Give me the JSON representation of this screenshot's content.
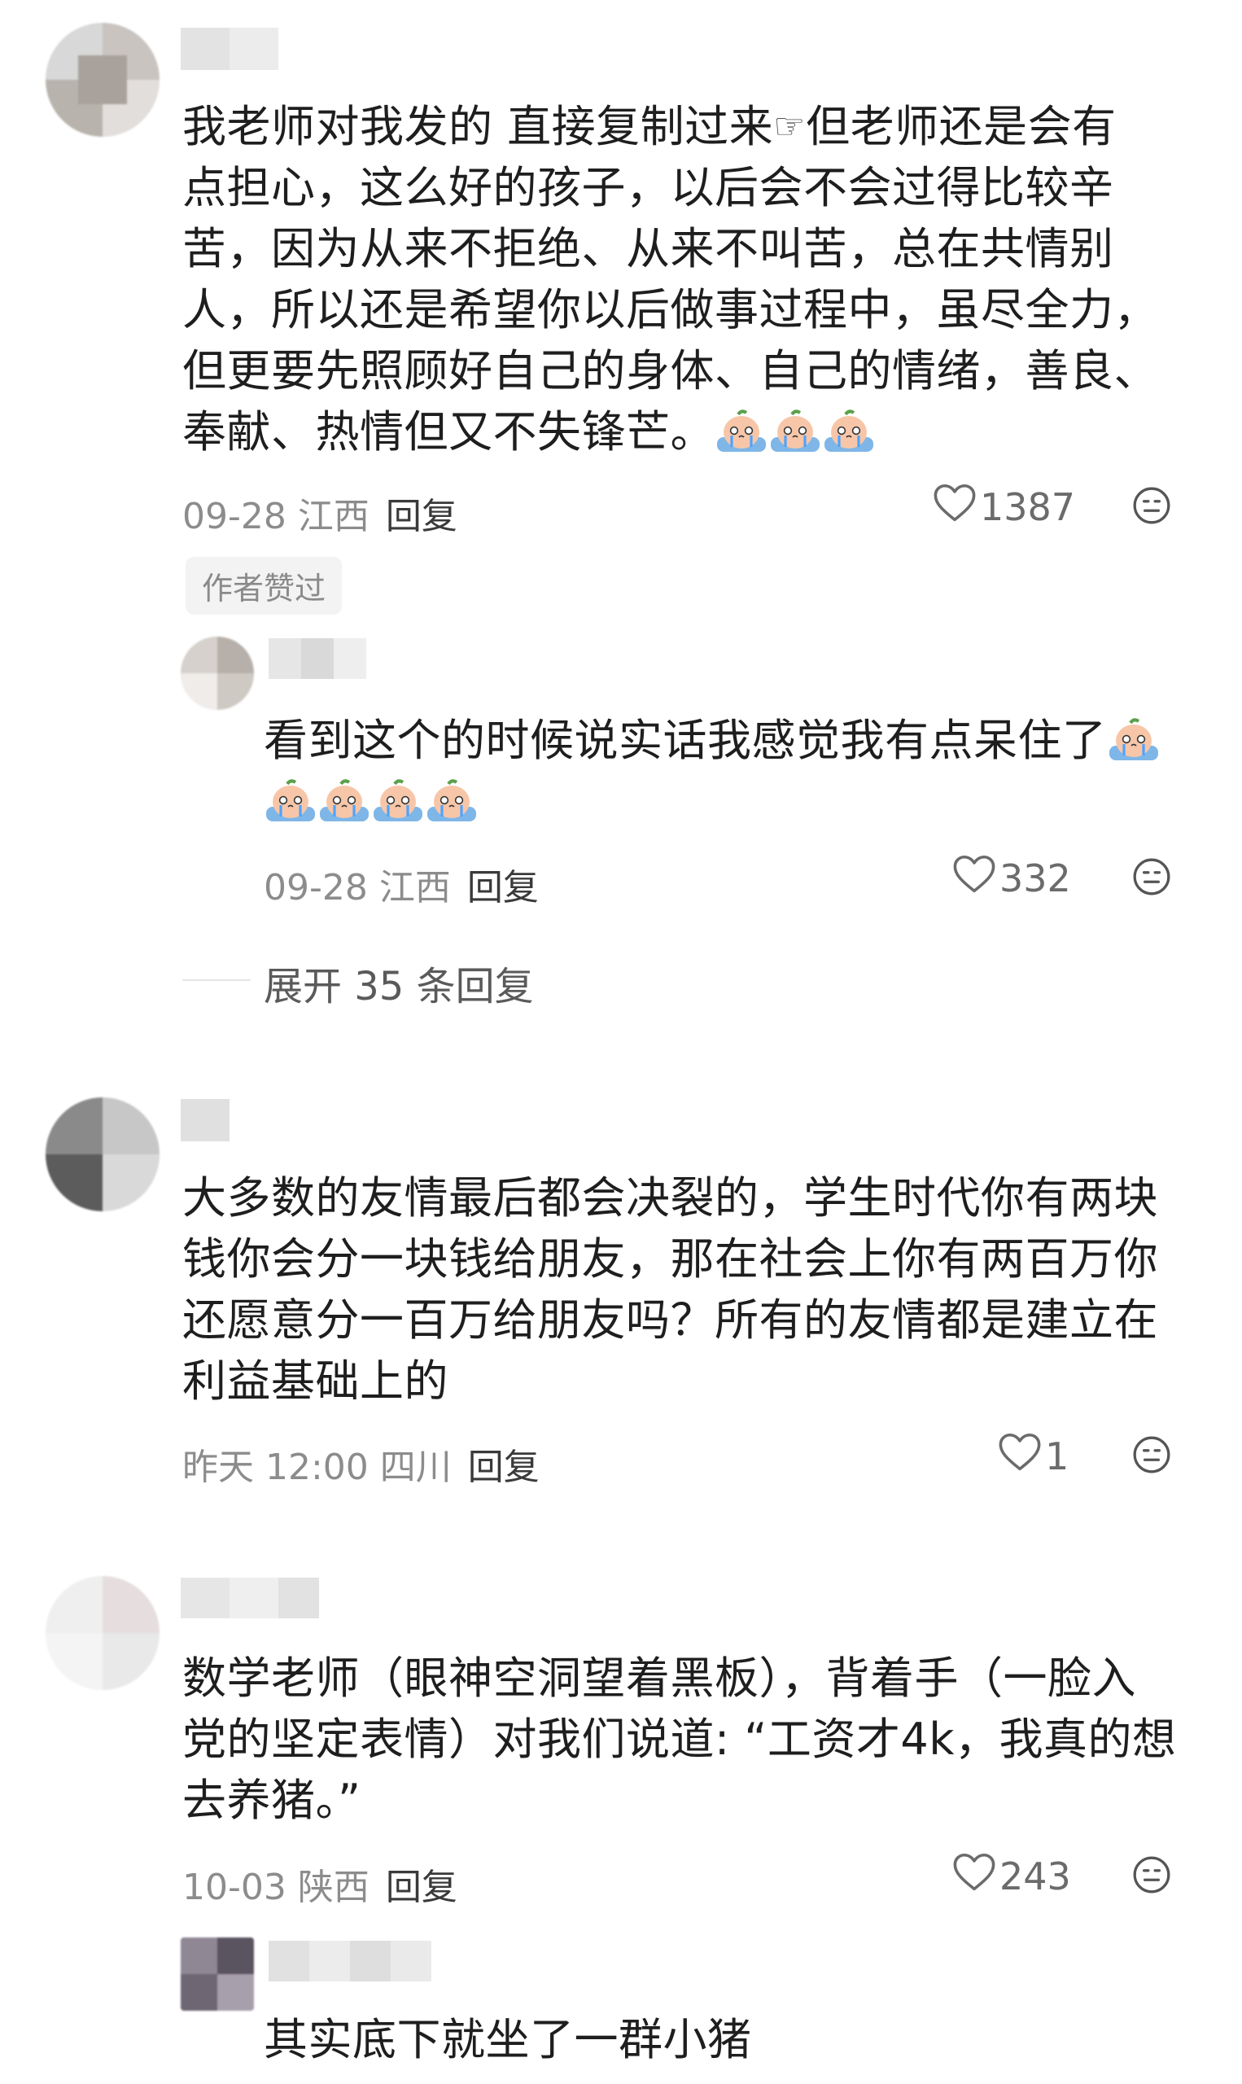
{
  "comments": [
    {
      "text_lines": [
        "我老师对我发的 直接复制过来",
        "点担心，这么好的孩子，以后会不会过得比较辛",
        "苦，因为从来不拒绝、从来不叫苦，总在共情别",
        "人，所以还是希望你以后做事过程中，虽尽全力，",
        "但更要先照顾好自己的身体、自己的情绪，善良、",
        "奉献、热情但又不失锋芒。"
      ],
      "line1_tail": "但老师还是会有",
      "hand_glyph": "☞",
      "date": "09-28",
      "location": "江西",
      "reply_label": "回复",
      "likes": "1387",
      "author_badge": "作者赞过"
    },
    {
      "text_lines": [
        "看到这个的时候说实话我感觉我有点呆住了"
      ],
      "date": "09-28",
      "location": "江西",
      "reply_label": "回复",
      "likes": "332",
      "expand_label": "展开 35 条回复"
    },
    {
      "text_lines": [
        "大多数的友情最后都会决裂的，学生时代你有两块",
        "钱你会分一块钱给朋友，那在社会上你有两百万你",
        "还愿意分一百万给朋友吗？所有的友情都是建立在",
        "利益基础上的"
      ],
      "date": "昨天 12:00",
      "location": "四川",
      "reply_label": "回复",
      "likes": "1"
    },
    {
      "text_lines": [
        "数学老师（眼神空洞望着黑板），背着手（一脸入",
        "党的坚定表情）对我们说道: “工资才4k，我真的想",
        "去养猪。”"
      ],
      "date": "10-03",
      "location": "陕西",
      "reply_label": "回复",
      "likes": "243"
    },
    {
      "text_lines": [
        "其实底下就坐了一群小猪"
      ]
    }
  ],
  "icons": {
    "like": "heart-outline-icon",
    "more": "face-more-icon",
    "emoji": "crying-emoji"
  }
}
